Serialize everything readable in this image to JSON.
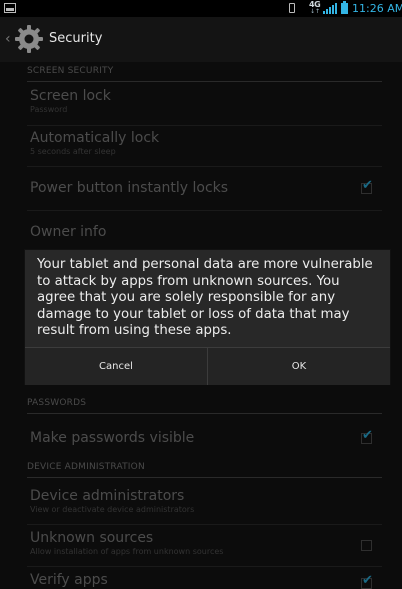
{
  "status_bar": {
    "network": "4G",
    "network_arrows": "↓↑",
    "time": "11:26 AM"
  },
  "action_bar": {
    "title": "Security",
    "icon": "gear-icon"
  },
  "sections": {
    "screen_security": "SCREEN SECURITY",
    "passwords": "PASSWORDS",
    "device_administration": "DEVICE ADMINISTRATION"
  },
  "settings": {
    "screen_lock": {
      "title": "Screen lock",
      "summary": "Password"
    },
    "auto_lock": {
      "title": "Automatically lock",
      "summary": "5 seconds after sleep"
    },
    "power_button": {
      "title": "Power button instantly locks",
      "checked": true
    },
    "owner_info": {
      "title": "Owner info"
    },
    "make_passwords_visible": {
      "title": "Make passwords visible",
      "checked": true
    },
    "device_admins": {
      "title": "Device administrators",
      "summary": "View or deactivate device administrators"
    },
    "unknown_sources": {
      "title": "Unknown sources",
      "summary": "Allow installation of apps from unknown sources",
      "checked": false
    },
    "verify_apps": {
      "title": "Verify apps",
      "checked": true
    }
  },
  "dialog": {
    "message": "Your tablet and personal data are more vulnerable to attack by apps from unknown sources. You agree that you are solely responsible for any damage to your tablet or loss of data that may result from using these apps.",
    "cancel_label": "Cancel",
    "ok_label": "OK"
  },
  "colors": {
    "accent": "#33b5e5",
    "dialog_bg": "#282828",
    "background": "#0c0c0c"
  }
}
